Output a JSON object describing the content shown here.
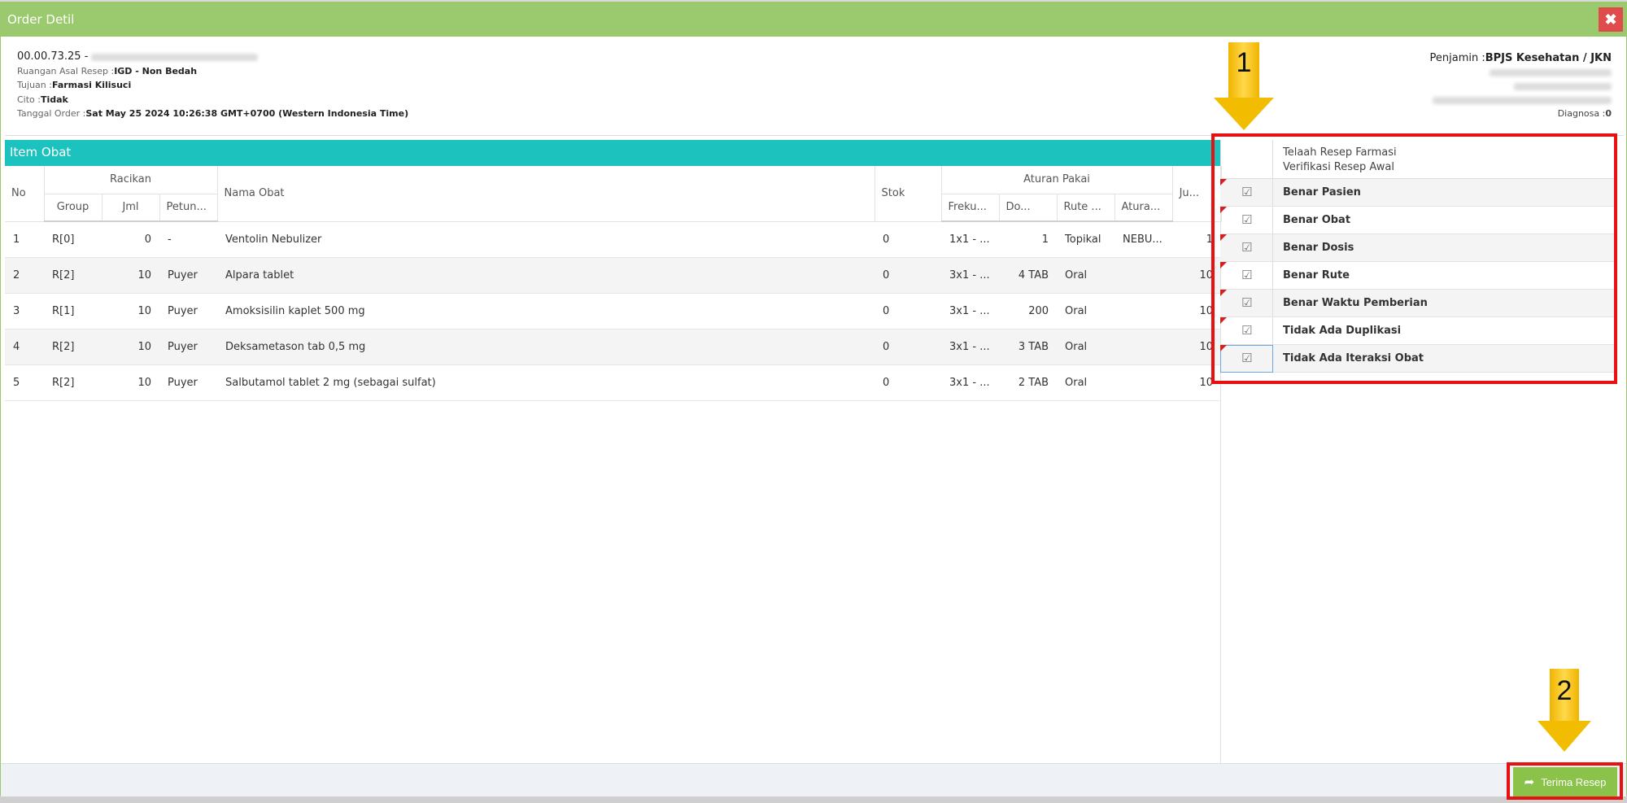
{
  "dialog": {
    "title": "Order Detil",
    "close_glyph": "✖"
  },
  "info": {
    "rm": "00.00.73.25 -",
    "asal_label": "Ruangan Asal Resep :",
    "asal_value": "IGD - Non Bedah",
    "tujuan_label": "Tujuan :",
    "tujuan_value": "Farmasi Kilisuci",
    "cito_label": "Cito :",
    "cito_value": "Tidak",
    "tanggal_label": "Tanggal Order :",
    "tanggal_value": "Sat May 25 2024 10:26:38 GMT+0700 (Western Indonesia Time)"
  },
  "info_right": {
    "penjamin_label": "Penjamin :",
    "penjamin_value": "BPJS Kesehatan / JKN",
    "diagnosa_label": "Diagnosa :",
    "diagnosa_value": "0"
  },
  "items": {
    "title": "Item Obat",
    "headers": {
      "no": "No",
      "racikan": "Racikan",
      "group": "Group",
      "jml": "Jml",
      "petunjuk": "Petun...",
      "nama": "Nama Obat",
      "stok": "Stok",
      "aturan": "Aturan Pakai",
      "frekuensi": "Freku...",
      "dosis": "Do...",
      "rute": "Rute ...",
      "aturan_pakai": "Atura...",
      "jumlah": "Ju..."
    },
    "rows": [
      {
        "no": "1",
        "group": "R[0]",
        "group_color": "blue",
        "jml": "0",
        "petunjuk": "-",
        "nama": "Ventolin Nebulizer",
        "stok": "0",
        "frekuensi": "1x1 - ...",
        "dosis": "1",
        "rute": "Topikal",
        "aturan": "NEBU...",
        "jumlah": "1"
      },
      {
        "no": "2",
        "group": "R[2]",
        "group_color": "red",
        "jml": "10",
        "petunjuk": "Puyer",
        "nama": "Alpara tablet",
        "stok": "0",
        "frekuensi": "3x1 - ...",
        "dosis": "4 TAB",
        "rute": "Oral",
        "aturan": "",
        "jumlah": "10"
      },
      {
        "no": "3",
        "group": "R[1]",
        "group_color": "red",
        "jml": "10",
        "petunjuk": "Puyer",
        "nama": "Amoksisilin kaplet 500 mg",
        "stok": "0",
        "frekuensi": "3x1 - ...",
        "dosis": "200",
        "rute": "Oral",
        "aturan": "",
        "jumlah": "10"
      },
      {
        "no": "4",
        "group": "R[2]",
        "group_color": "red",
        "jml": "10",
        "petunjuk": "Puyer",
        "nama": "Deksametason tab 0,5 mg",
        "stok": "0",
        "frekuensi": "3x1 - ...",
        "dosis": "3 TAB",
        "rute": "Oral",
        "aturan": "",
        "jumlah": "10"
      },
      {
        "no": "5",
        "group": "R[2]",
        "group_color": "red",
        "jml": "10",
        "petunjuk": "Puyer",
        "nama": "Salbutamol tablet 2 mg (sebagai sulfat)",
        "stok": "0",
        "frekuensi": "3x1 - ...",
        "dosis": "2 TAB",
        "rute": "Oral",
        "aturan": "",
        "jumlah": "10"
      }
    ]
  },
  "telaah": {
    "line1": "Telaah Resep Farmasi",
    "line2": "Verifikasi Resep Awal",
    "check_glyph": "☑",
    "items": [
      "Benar Pasien",
      "Benar Obat",
      "Benar Dosis",
      "Benar Rute",
      "Benar Waktu Pemberian",
      "Tidak Ada Duplikasi",
      "Tidak Ada Iteraksi Obat"
    ]
  },
  "annotations": {
    "one": "1",
    "two": "2"
  },
  "footer": {
    "accept_label": "Terima Resep",
    "accept_icon": "share-icon"
  },
  "colors": {
    "titlebar": "#9bc96e",
    "panel_head": "#1cc3be",
    "close": "#e04b4b",
    "accept": "#8bc34a",
    "highlight": "#e81010",
    "arrow": "#f5c400"
  }
}
